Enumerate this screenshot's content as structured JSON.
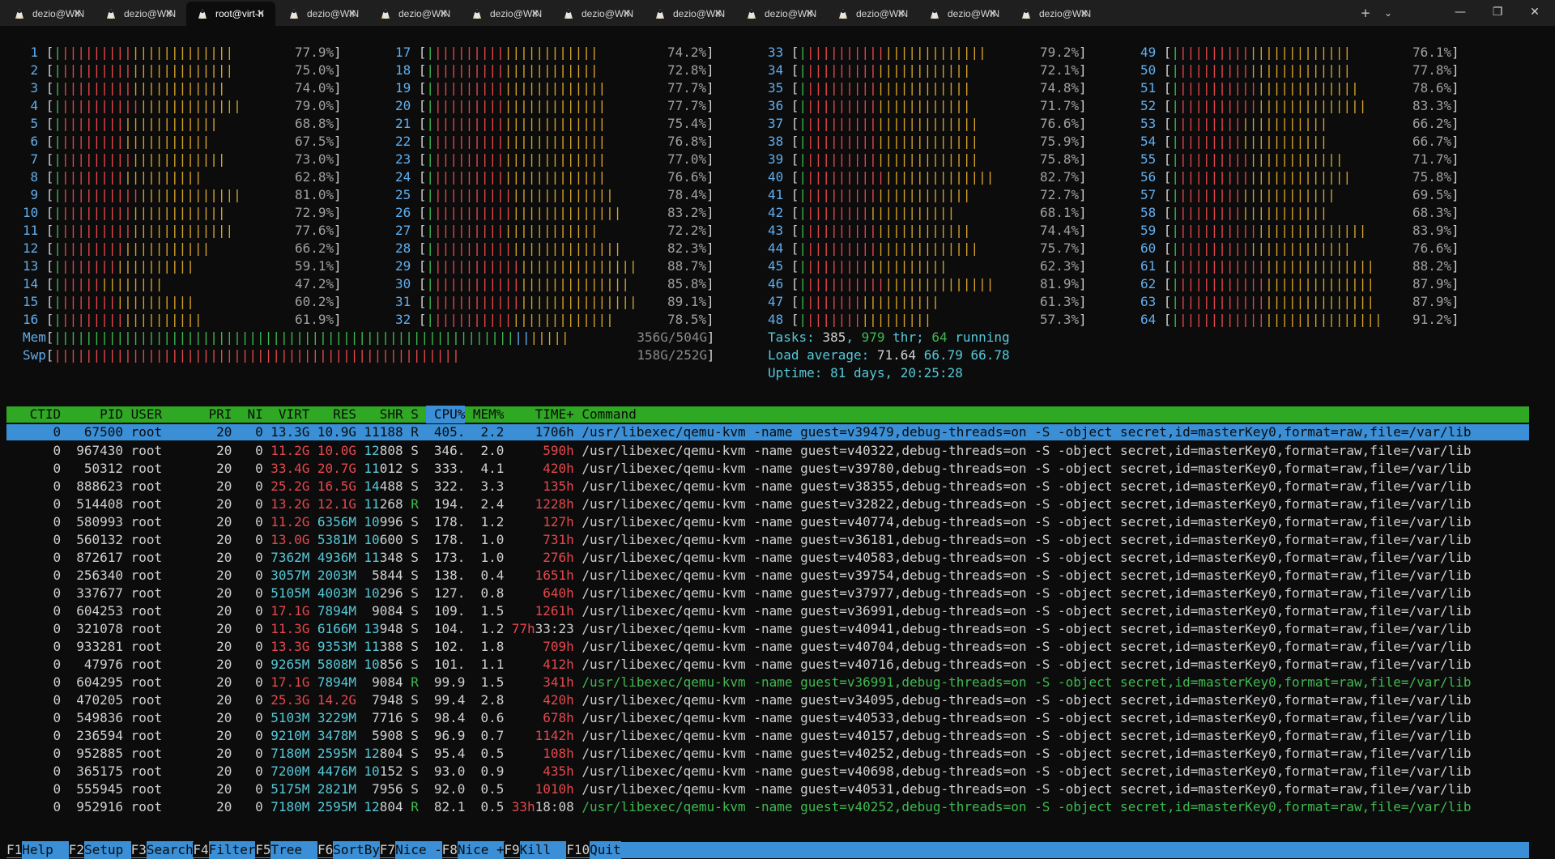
{
  "tabs": [
    {
      "label": "dezio@WIN",
      "active": false
    },
    {
      "label": "dezio@WIN",
      "active": false
    },
    {
      "label": "root@virt-h",
      "active": true
    },
    {
      "label": "dezio@WIN",
      "active": false
    },
    {
      "label": "dezio@WIN",
      "active": false
    },
    {
      "label": "dezio@WIN",
      "active": false
    },
    {
      "label": "dezio@WIN",
      "active": false
    },
    {
      "label": "dezio@WIN",
      "active": false
    },
    {
      "label": "dezio@WIN",
      "active": false
    },
    {
      "label": "dezio@WIN",
      "active": false
    },
    {
      "label": "dezio@WIN",
      "active": false
    },
    {
      "label": "dezio@WIN",
      "active": false
    }
  ],
  "tabbar": {
    "new_tab": "+",
    "dropdown": "⌄",
    "minimize": "—",
    "restore": "❐",
    "close": "✕",
    "tab_close": "✕"
  },
  "cpus": [
    {
      "n": "1",
      "pct": "77.9%"
    },
    {
      "n": "2",
      "pct": "75.0%"
    },
    {
      "n": "3",
      "pct": "74.0%"
    },
    {
      "n": "4",
      "pct": "79.0%"
    },
    {
      "n": "5",
      "pct": "68.8%"
    },
    {
      "n": "6",
      "pct": "67.5%"
    },
    {
      "n": "7",
      "pct": "73.0%"
    },
    {
      "n": "8",
      "pct": "62.8%"
    },
    {
      "n": "9",
      "pct": "81.0%"
    },
    {
      "n": "10",
      "pct": "72.9%"
    },
    {
      "n": "11",
      "pct": "77.6%"
    },
    {
      "n": "12",
      "pct": "66.2%"
    },
    {
      "n": "13",
      "pct": "59.1%"
    },
    {
      "n": "14",
      "pct": "47.2%"
    },
    {
      "n": "15",
      "pct": "60.2%"
    },
    {
      "n": "16",
      "pct": "61.9%"
    },
    {
      "n": "17",
      "pct": "74.2%"
    },
    {
      "n": "18",
      "pct": "72.8%"
    },
    {
      "n": "19",
      "pct": "77.7%"
    },
    {
      "n": "20",
      "pct": "77.7%"
    },
    {
      "n": "21",
      "pct": "75.4%"
    },
    {
      "n": "22",
      "pct": "76.8%"
    },
    {
      "n": "23",
      "pct": "77.0%"
    },
    {
      "n": "24",
      "pct": "76.6%"
    },
    {
      "n": "25",
      "pct": "78.4%"
    },
    {
      "n": "26",
      "pct": "83.2%"
    },
    {
      "n": "27",
      "pct": "72.2%"
    },
    {
      "n": "28",
      "pct": "82.3%"
    },
    {
      "n": "29",
      "pct": "88.7%"
    },
    {
      "n": "30",
      "pct": "85.8%"
    },
    {
      "n": "31",
      "pct": "89.1%"
    },
    {
      "n": "32",
      "pct": "78.5%"
    },
    {
      "n": "33",
      "pct": "79.2%"
    },
    {
      "n": "34",
      "pct": "72.1%"
    },
    {
      "n": "35",
      "pct": "74.8%"
    },
    {
      "n": "36",
      "pct": "71.7%"
    },
    {
      "n": "37",
      "pct": "76.6%"
    },
    {
      "n": "38",
      "pct": "75.9%"
    },
    {
      "n": "39",
      "pct": "75.8%"
    },
    {
      "n": "40",
      "pct": "82.7%"
    },
    {
      "n": "41",
      "pct": "72.7%"
    },
    {
      "n": "42",
      "pct": "68.1%"
    },
    {
      "n": "43",
      "pct": "74.4%"
    },
    {
      "n": "44",
      "pct": "75.7%"
    },
    {
      "n": "45",
      "pct": "62.3%"
    },
    {
      "n": "46",
      "pct": "81.9%"
    },
    {
      "n": "47",
      "pct": "61.3%"
    },
    {
      "n": "48",
      "pct": "57.3%"
    },
    {
      "n": "49",
      "pct": "76.1%"
    },
    {
      "n": "50",
      "pct": "77.8%"
    },
    {
      "n": "51",
      "pct": "78.6%"
    },
    {
      "n": "52",
      "pct": "83.3%"
    },
    {
      "n": "53",
      "pct": "66.2%"
    },
    {
      "n": "54",
      "pct": "66.7%"
    },
    {
      "n": "55",
      "pct": "71.7%"
    },
    {
      "n": "56",
      "pct": "75.8%"
    },
    {
      "n": "57",
      "pct": "69.5%"
    },
    {
      "n": "58",
      "pct": "68.3%"
    },
    {
      "n": "59",
      "pct": "83.9%"
    },
    {
      "n": "60",
      "pct": "76.6%"
    },
    {
      "n": "61",
      "pct": "88.2%"
    },
    {
      "n": "62",
      "pct": "87.9%"
    },
    {
      "n": "63",
      "pct": "87.9%"
    },
    {
      "n": "64",
      "pct": "91.2%"
    }
  ],
  "mem": {
    "label": "Mem",
    "value": "356G/504G",
    "fraction": 0.706
  },
  "swp": {
    "label": "Swp",
    "value": "158G/252G",
    "fraction": 0.627
  },
  "tasks": {
    "label": "Tasks:",
    "tasks": "385",
    "sep1": ",",
    "thr": "979",
    "thr_label": "thr;",
    "running": "64",
    "running_label": "running"
  },
  "load": {
    "label": "Load average:",
    "v1": "71.64",
    "v2": "66.79",
    "v3": "66.78"
  },
  "uptime": {
    "label": "Uptime:",
    "value": "81 days, 20:25:28"
  },
  "header": {
    "ctid": "CTID",
    "pid": "PID",
    "user": "USER",
    "pri": "PRI",
    "ni": "NI",
    "virt": "VIRT",
    "res": "RES",
    "shr": "SHR",
    "s": "S",
    "cpu": "CPU%",
    "mem": "MEM%",
    "time": "TIME+",
    "cmd": "Command"
  },
  "rows": [
    {
      "ctid": "0",
      "pid": "67500",
      "user": "root",
      "pri": "20",
      "ni": "0",
      "virt": "13.3G",
      "res": "10.9G",
      "shr": "11188",
      "s": "R",
      "cpu": "405.",
      "mem": "2.2",
      "time": "1706h",
      "cmd": "/usr/libexec/qemu-kvm -name guest=v39479,debug-threads=on -S -object secret,id=masterKey0,format=raw,file=/var/lib",
      "selected": true
    },
    {
      "ctid": "0",
      "pid": "967430",
      "user": "root",
      "pri": "20",
      "ni": "0",
      "virt": "11.2G",
      "res": "10.0G",
      "shr": "12808",
      "s": "S",
      "cpu": "346.",
      "mem": "2.0",
      "time": "590h",
      "cmd": "/usr/libexec/qemu-kvm -name guest=v40322,debug-threads=on -S -object secret,id=masterKey0,format=raw,file=/var/lib"
    },
    {
      "ctid": "0",
      "pid": "50312",
      "user": "root",
      "pri": "20",
      "ni": "0",
      "virt": "33.4G",
      "res": "20.7G",
      "shr": "11012",
      "s": "S",
      "cpu": "333.",
      "mem": "4.1",
      "time": "420h",
      "cmd": "/usr/libexec/qemu-kvm -name guest=v39780,debug-threads=on -S -object secret,id=masterKey0,format=raw,file=/var/lib"
    },
    {
      "ctid": "0",
      "pid": "888623",
      "user": "root",
      "pri": "20",
      "ni": "0",
      "virt": "25.2G",
      "res": "16.5G",
      "shr": "14488",
      "s": "S",
      "cpu": "322.",
      "mem": "3.3",
      "time": "135h",
      "cmd": "/usr/libexec/qemu-kvm -name guest=v38355,debug-threads=on -S -object secret,id=masterKey0,format=raw,file=/var/lib"
    },
    {
      "ctid": "0",
      "pid": "514408",
      "user": "root",
      "pri": "20",
      "ni": "0",
      "virt": "13.2G",
      "res": "12.1G",
      "shr": "11268",
      "s": "R",
      "cpu": "194.",
      "mem": "2.4",
      "time": "1228h",
      "cmd": "/usr/libexec/qemu-kvm -name guest=v32822,debug-threads=on -S -object secret,id=masterKey0,format=raw,file=/var/lib"
    },
    {
      "ctid": "0",
      "pid": "580993",
      "user": "root",
      "pri": "20",
      "ni": "0",
      "virt": "11.2G",
      "res": "6356M",
      "shr": "10996",
      "s": "S",
      "cpu": "178.",
      "mem": "1.2",
      "time": "127h",
      "cmd": "/usr/libexec/qemu-kvm -name guest=v40774,debug-threads=on -S -object secret,id=masterKey0,format=raw,file=/var/lib"
    },
    {
      "ctid": "0",
      "pid": "560132",
      "user": "root",
      "pri": "20",
      "ni": "0",
      "virt": "13.0G",
      "res": "5381M",
      "shr": "10600",
      "s": "S",
      "cpu": "178.",
      "mem": "1.0",
      "time": "731h",
      "cmd": "/usr/libexec/qemu-kvm -name guest=v36181,debug-threads=on -S -object secret,id=masterKey0,format=raw,file=/var/lib"
    },
    {
      "ctid": "0",
      "pid": "872617",
      "user": "root",
      "pri": "20",
      "ni": "0",
      "virt": "7362M",
      "res": "4936M",
      "shr": "11348",
      "s": "S",
      "cpu": "173.",
      "mem": "1.0",
      "time": "276h",
      "cmd": "/usr/libexec/qemu-kvm -name guest=v40583,debug-threads=on -S -object secret,id=masterKey0,format=raw,file=/var/lib"
    },
    {
      "ctid": "0",
      "pid": "256340",
      "user": "root",
      "pri": "20",
      "ni": "0",
      "virt": "3057M",
      "res": "2003M",
      "shr": "5844",
      "s": "S",
      "cpu": "138.",
      "mem": "0.4",
      "time": "1651h",
      "cmd": "/usr/libexec/qemu-kvm -name guest=v39754,debug-threads=on -S -object secret,id=masterKey0,format=raw,file=/var/lib"
    },
    {
      "ctid": "0",
      "pid": "337677",
      "user": "root",
      "pri": "20",
      "ni": "0",
      "virt": "5105M",
      "res": "4003M",
      "shr": "10296",
      "s": "S",
      "cpu": "127.",
      "mem": "0.8",
      "time": "640h",
      "cmd": "/usr/libexec/qemu-kvm -name guest=v37977,debug-threads=on -S -object secret,id=masterKey0,format=raw,file=/var/lib"
    },
    {
      "ctid": "0",
      "pid": "604253",
      "user": "root",
      "pri": "20",
      "ni": "0",
      "virt": "17.1G",
      "res": "7894M",
      "shr": "9084",
      "s": "S",
      "cpu": "109.",
      "mem": "1.5",
      "time": "1261h",
      "cmd": "/usr/libexec/qemu-kvm -name guest=v36991,debug-threads=on -S -object secret,id=masterKey0,format=raw,file=/var/lib"
    },
    {
      "ctid": "0",
      "pid": "321078",
      "user": "root",
      "pri": "20",
      "ni": "0",
      "virt": "11.3G",
      "res": "6166M",
      "shr": "13948",
      "s": "S",
      "cpu": "104.",
      "mem": "1.2",
      "time": "77h33:23",
      "cmd": "/usr/libexec/qemu-kvm -name guest=v40941,debug-threads=on -S -object secret,id=masterKey0,format=raw,file=/var/lib"
    },
    {
      "ctid": "0",
      "pid": "933281",
      "user": "root",
      "pri": "20",
      "ni": "0",
      "virt": "13.3G",
      "res": "9353M",
      "shr": "11388",
      "s": "S",
      "cpu": "102.",
      "mem": "1.8",
      "time": "709h",
      "cmd": "/usr/libexec/qemu-kvm -name guest=v40704,debug-threads=on -S -object secret,id=masterKey0,format=raw,file=/var/lib"
    },
    {
      "ctid": "0",
      "pid": "47976",
      "user": "root",
      "pri": "20",
      "ni": "0",
      "virt": "9265M",
      "res": "5808M",
      "shr": "10856",
      "s": "S",
      "cpu": "101.",
      "mem": "1.1",
      "time": "412h",
      "cmd": "/usr/libexec/qemu-kvm -name guest=v40716,debug-threads=on -S -object secret,id=masterKey0,format=raw,file=/var/lib"
    },
    {
      "ctid": "0",
      "pid": "604295",
      "user": "root",
      "pri": "20",
      "ni": "0",
      "virt": "17.1G",
      "res": "7894M",
      "shr": "9084",
      "s": "R",
      "cpu": "99.9",
      "mem": "1.5",
      "time": "341h",
      "cmd": "/usr/libexec/qemu-kvm -name guest=v36991,debug-threads=on -S -object secret,id=masterKey0,format=raw,file=/var/lib",
      "thread": true
    },
    {
      "ctid": "0",
      "pid": "470205",
      "user": "root",
      "pri": "20",
      "ni": "0",
      "virt": "25.3G",
      "res": "14.2G",
      "shr": "7948",
      "s": "S",
      "cpu": "99.4",
      "mem": "2.8",
      "time": "420h",
      "cmd": "/usr/libexec/qemu-kvm -name guest=v34095,debug-threads=on -S -object secret,id=masterKey0,format=raw,file=/var/lib"
    },
    {
      "ctid": "0",
      "pid": "549836",
      "user": "root",
      "pri": "20",
      "ni": "0",
      "virt": "5103M",
      "res": "3229M",
      "shr": "7716",
      "s": "S",
      "cpu": "98.4",
      "mem": "0.6",
      "time": "678h",
      "cmd": "/usr/libexec/qemu-kvm -name guest=v40533,debug-threads=on -S -object secret,id=masterKey0,format=raw,file=/var/lib"
    },
    {
      "ctid": "0",
      "pid": "236594",
      "user": "root",
      "pri": "20",
      "ni": "0",
      "virt": "9210M",
      "res": "3478M",
      "shr": "5908",
      "s": "S",
      "cpu": "96.9",
      "mem": "0.7",
      "time": "1142h",
      "cmd": "/usr/libexec/qemu-kvm -name guest=v40157,debug-threads=on -S -object secret,id=masterKey0,format=raw,file=/var/lib"
    },
    {
      "ctid": "0",
      "pid": "952885",
      "user": "root",
      "pri": "20",
      "ni": "0",
      "virt": "7180M",
      "res": "2595M",
      "shr": "12804",
      "s": "S",
      "cpu": "95.4",
      "mem": "0.5",
      "time": "108h",
      "cmd": "/usr/libexec/qemu-kvm -name guest=v40252,debug-threads=on -S -object secret,id=masterKey0,format=raw,file=/var/lib"
    },
    {
      "ctid": "0",
      "pid": "365175",
      "user": "root",
      "pri": "20",
      "ni": "0",
      "virt": "7200M",
      "res": "4476M",
      "shr": "10152",
      "s": "S",
      "cpu": "93.0",
      "mem": "0.9",
      "time": "435h",
      "cmd": "/usr/libexec/qemu-kvm -name guest=v40698,debug-threads=on -S -object secret,id=masterKey0,format=raw,file=/var/lib"
    },
    {
      "ctid": "0",
      "pid": "555945",
      "user": "root",
      "pri": "20",
      "ni": "0",
      "virt": "5175M",
      "res": "2821M",
      "shr": "7956",
      "s": "S",
      "cpu": "92.0",
      "mem": "0.5",
      "time": "1010h",
      "cmd": "/usr/libexec/qemu-kvm -name guest=v40531,debug-threads=on -S -object secret,id=masterKey0,format=raw,file=/var/lib"
    },
    {
      "ctid": "0",
      "pid": "952916",
      "user": "root",
      "pri": "20",
      "ni": "0",
      "virt": "7180M",
      "res": "2595M",
      "shr": "12804",
      "s": "R",
      "cpu": "82.1",
      "mem": "0.5",
      "time": "33h18:08",
      "cmd": "/usr/libexec/qemu-kvm -name guest=v40252,debug-threads=on -S -object secret,id=masterKey0,format=raw,file=/var/lib",
      "thread": true
    }
  ],
  "fkeys": [
    {
      "key": "F1",
      "label": "Help  "
    },
    {
      "key": "F2",
      "label": "Setup "
    },
    {
      "key": "F3",
      "label": "Search"
    },
    {
      "key": "F4",
      "label": "Filter"
    },
    {
      "key": "F5",
      "label": "Tree  "
    },
    {
      "key": "F6",
      "label": "SortBy"
    },
    {
      "key": "F7",
      "label": "Nice -"
    },
    {
      "key": "F8",
      "label": "Nice +"
    },
    {
      "key": "F9",
      "label": "Kill  "
    },
    {
      "key": "F10",
      "label": "Quit"
    }
  ],
  "colors": {
    "bg": "#0c0c0c",
    "header_bg": "#2fa824",
    "selected_bg": "#3a8fd6",
    "bar_green": "#3fb950",
    "bar_red": "#e5484d",
    "bar_yellow": "#d7a32a",
    "label_blue": "#61aeee",
    "value_cyan": "#56c8d8"
  }
}
